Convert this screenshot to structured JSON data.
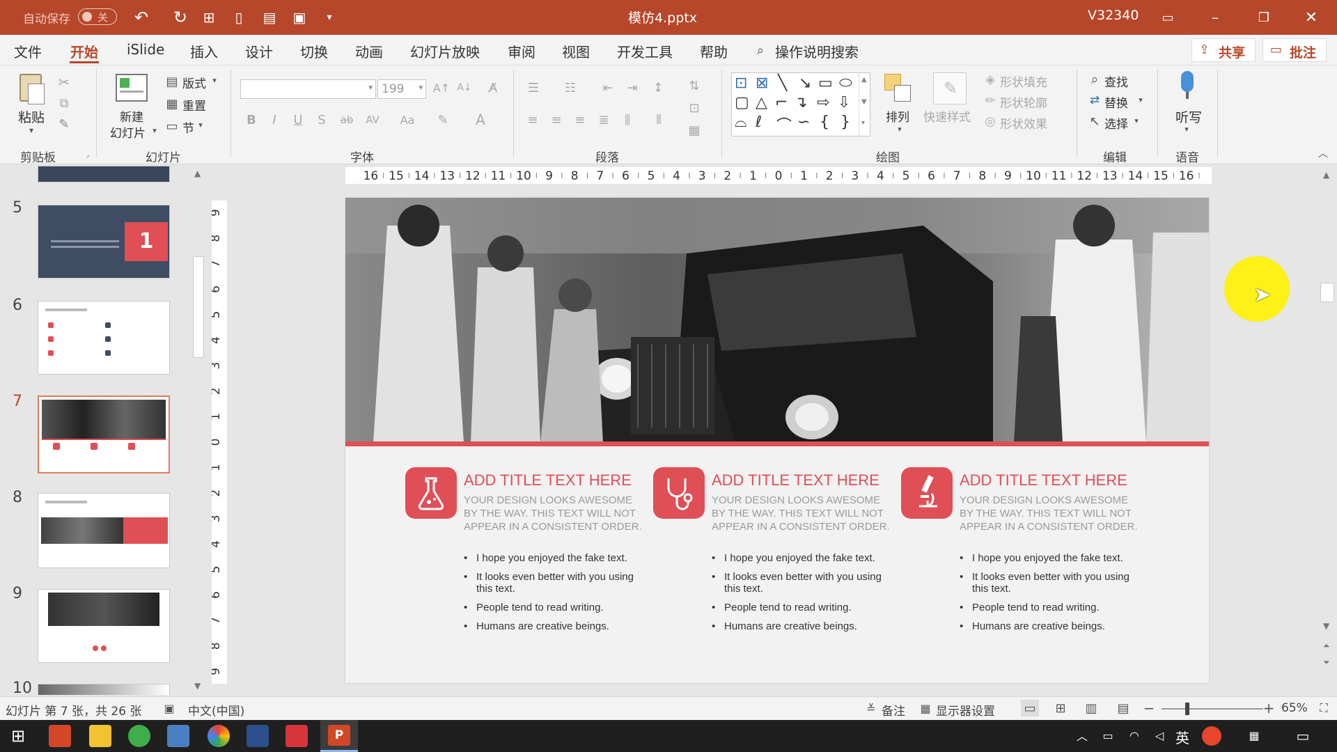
{
  "titlebar": {
    "autosave_label": "自动保存",
    "autosave_state": "关",
    "filename": "模仿4.pptx",
    "version": "V32340"
  },
  "menu": {
    "items": [
      "文件",
      "开始",
      "iSlide",
      "插入",
      "设计",
      "切换",
      "动画",
      "幻灯片放映",
      "审阅",
      "视图",
      "开发工具",
      "帮助"
    ],
    "search_label": "操作说明搜索",
    "share_label": "共享",
    "comment_label": "批注"
  },
  "ribbon": {
    "clipboard": {
      "paste": "粘贴",
      "group": "剪贴板"
    },
    "slides": {
      "new_slide_1": "新建",
      "new_slide_2": "幻灯片",
      "layout": "版式",
      "reset": "重置",
      "section": "节",
      "group": "幻灯片"
    },
    "font": {
      "size": "199",
      "group": "字体"
    },
    "paragraph": {
      "group": "段落"
    },
    "drawing": {
      "arrange": "排列",
      "quick_styles": "快速样式",
      "shape_fill": "形状填充",
      "shape_outline": "形状轮廓",
      "shape_effects": "形状效果",
      "group": "绘图"
    },
    "editing": {
      "find": "查找",
      "replace": "替换",
      "select": "选择",
      "group": "编辑"
    },
    "voice": {
      "dictate": "听写",
      "group": "语音"
    }
  },
  "thumbnails": [
    {
      "number": "5"
    },
    {
      "number": "6"
    },
    {
      "number": "7"
    },
    {
      "number": "8"
    },
    {
      "number": "9"
    },
    {
      "number": "10"
    }
  ],
  "slide": {
    "columns": [
      {
        "title": "ADD TITLE TEXT HERE",
        "subtitle": "YOUR DESIGN LOOKS AWESOME BY THE WAY. THIS TEXT WILL NOT APPEAR IN A CONSISTENT ORDER.",
        "bullets": [
          "I hope you enjoyed the fake text.",
          "It looks even better with you using this text.",
          "People tend to read writing.",
          "Humans are creative beings."
        ],
        "icon": "flask-icon"
      },
      {
        "title": "ADD TITLE TEXT HERE",
        "subtitle": "YOUR DESIGN LOOKS AWESOME BY THE WAY. THIS TEXT WILL NOT APPEAR IN A CONSISTENT ORDER.",
        "bullets": [
          "I hope you enjoyed the fake text.",
          "It looks even better with you using this text.",
          "People tend to read writing.",
          "Humans are creative beings."
        ],
        "icon": "stethoscope-icon"
      },
      {
        "title": "ADD TITLE TEXT HERE",
        "subtitle": "YOUR DESIGN LOOKS AWESOME BY THE WAY. THIS TEXT WILL NOT APPEAR IN A CONSISTENT ORDER.",
        "bullets": [
          "I hope you enjoyed the fake text.",
          "It looks even better with you using this text.",
          "People tend to read writing.",
          "Humans are creative beings."
        ],
        "icon": "microscope-icon"
      }
    ]
  },
  "status": {
    "slide_info": "幻灯片 第 7 张，共 26 张",
    "language": "中文(中国)",
    "notes": "备注",
    "display_settings": "显示器设置",
    "zoom": "65%"
  },
  "taskbar": {
    "ime": "英"
  },
  "colors": {
    "accent": "#b7472a",
    "slide_red": "#e04e56"
  }
}
